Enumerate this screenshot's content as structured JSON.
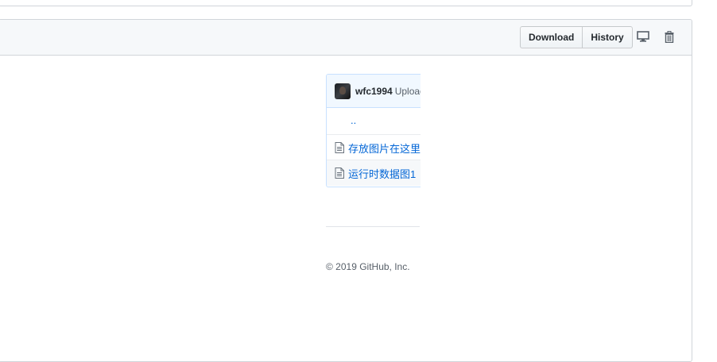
{
  "file_header": {
    "download_label": "Download",
    "history_label": "History",
    "display_icon": "desktop-icon",
    "delete_icon": "trash-icon"
  },
  "embed": {
    "commit": {
      "author": "wfc1994",
      "message_partial": "Uploac"
    },
    "parent_dir": "..",
    "files": [
      {
        "name": "存放图片在这里",
        "icon": "file-icon"
      },
      {
        "name": "运行时数据图1",
        "icon": "file-icon"
      }
    ]
  },
  "footer": {
    "copyright": "© 2019 GitHub, Inc."
  },
  "colors": {
    "link": "#0366d6",
    "header_bg": "#f6f8fa",
    "border": "#d1d5da",
    "commit_bg": "#f1f8ff"
  }
}
